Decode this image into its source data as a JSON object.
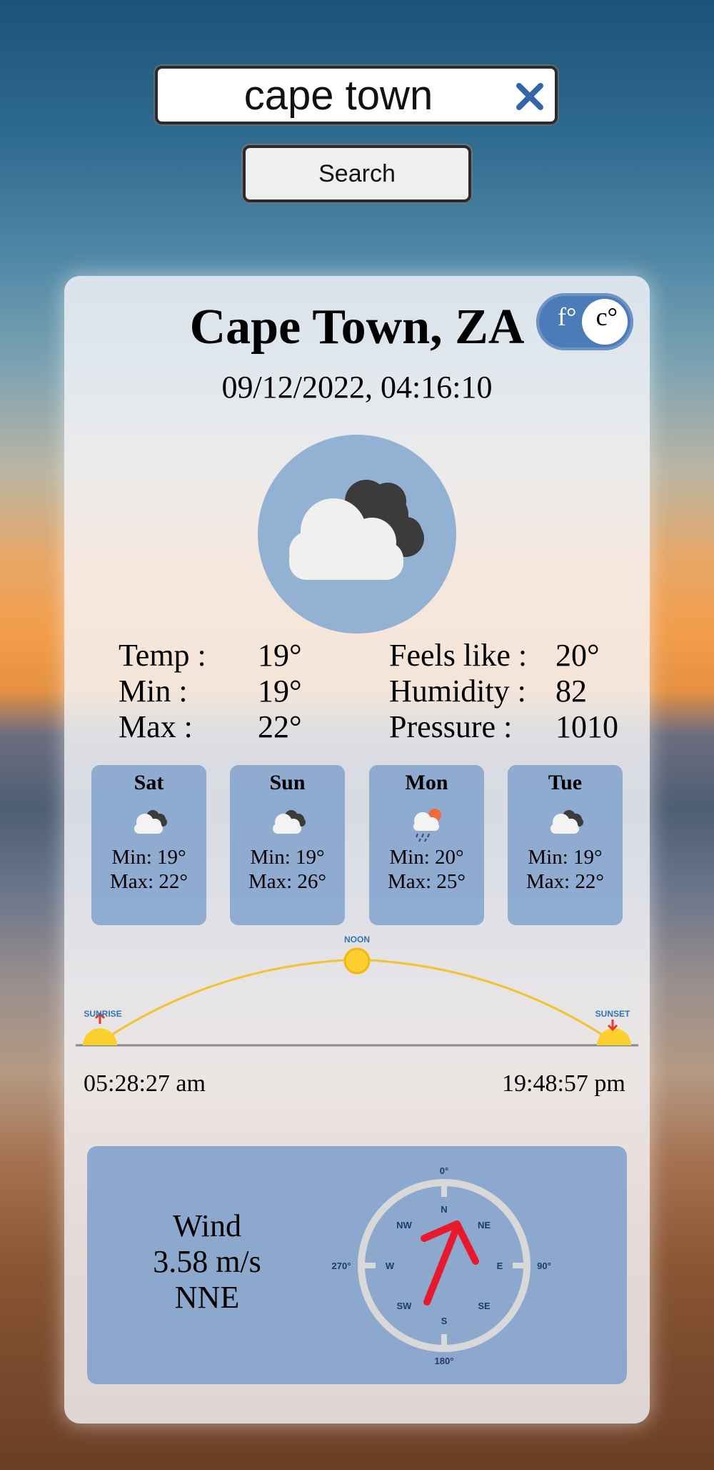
{
  "search": {
    "value": "cape town",
    "button_label": "Search"
  },
  "location": {
    "city": "Cape Town, ZA",
    "datetime": "09/12/2022, 04:16:10"
  },
  "units": {
    "fahrenheit": "f°",
    "celsius": "c°",
    "selected": "celsius"
  },
  "current": {
    "icon": "cloudy-icon",
    "rows_left": [
      {
        "label": "Temp :",
        "value": "19°"
      },
      {
        "label": "Min :",
        "value": "19°"
      },
      {
        "label": "Max :",
        "value": "22°"
      }
    ],
    "rows_right": [
      {
        "label": "Feels like :",
        "value": "20°"
      },
      {
        "label": "Humidity :",
        "value": "82"
      },
      {
        "label": "Pressure :",
        "value": "1010"
      }
    ]
  },
  "forecast": [
    {
      "day": "Sat",
      "icon": "cloudy-icon",
      "min": "Min: 19°",
      "max": "Max: 22°"
    },
    {
      "day": "Sun",
      "icon": "cloudy-icon",
      "min": "Min: 19°",
      "max": "Max: 26°"
    },
    {
      "day": "Mon",
      "icon": "rain-icon",
      "min": "Min: 20°",
      "max": "Max: 25°"
    },
    {
      "day": "Tue",
      "icon": "cloudy-icon",
      "min": "Min: 19°",
      "max": "Max: 22°"
    }
  ],
  "sun": {
    "sunrise_label": "SUNRISE",
    "noon_label": "NOON",
    "sunset_label": "SUNSET",
    "sunrise": "05:28:27 am",
    "sunset": "19:48:57 pm"
  },
  "wind": {
    "title": "Wind",
    "speed": "3.58 m/s",
    "direction": "NNE",
    "compass": {
      "n": "N",
      "ne": "NE",
      "e": "E",
      "se": "SE",
      "s": "S",
      "sw": "SW",
      "w": "W",
      "nw": "NW",
      "deg0": "0°",
      "deg90": "90°",
      "deg180": "180°",
      "deg270": "270°"
    }
  },
  "colors": {
    "accent": "#4b7bb8",
    "arrow": "#e8192c",
    "sun_arc": "#f2c230",
    "card_tile": "#81a2cd"
  }
}
